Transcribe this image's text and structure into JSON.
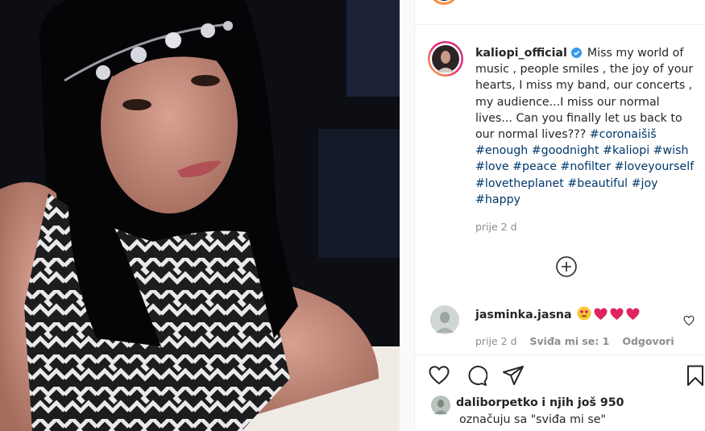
{
  "post": {
    "username": "kaliopi_official",
    "caption_intro": "Miss my world of music , people smiles , the joy of your hearts, I miss my band, our concerts , my audience...I miss our normal lives... Can you finally let us back to our normal lives???",
    "hashtags": [
      "#coronaišiš",
      "#enough",
      "#goodnight",
      "#kaliopi",
      "#wish",
      "#love",
      "#peace",
      "#nofilter",
      "#loveyourself",
      "#lovetheplanet",
      "#beautiful",
      "#joy",
      "#happy"
    ],
    "time": "prije 2 d"
  },
  "comment": {
    "username": "jasminka.jasna",
    "time": "prije 2 d",
    "likes_label": "Sviđa mi se: 1",
    "reply_label": "Odgovori"
  },
  "likes": {
    "username": "daliborpetko",
    "rest": "i njih još 950",
    "suffix": "označuju sa \"sviđa mi se\""
  },
  "icons": {
    "verified": "verified-badge-icon",
    "load_more": "plus-circle-icon",
    "like": "heart-outline-icon",
    "comment": "speech-bubble-icon",
    "share": "paper-plane-icon",
    "save": "bookmark-icon",
    "comment_like": "small-heart-icon"
  },
  "colors": {
    "hashtag": "#00376b",
    "verified": "#3897f0",
    "muted": "#8e8e8e",
    "text": "#262626"
  }
}
